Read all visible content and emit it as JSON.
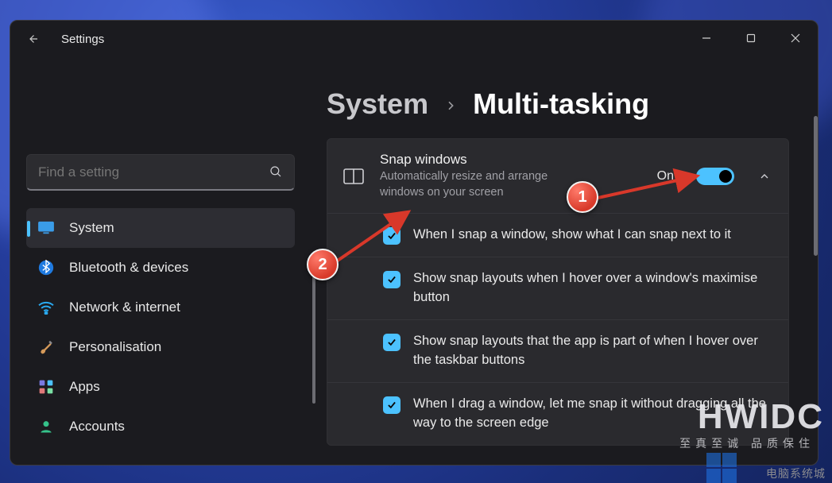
{
  "window": {
    "back_tooltip": "Back",
    "title": "Settings",
    "controls": {
      "minimize": "Minimize",
      "maximize": "Maximize",
      "close": "Close"
    }
  },
  "search": {
    "placeholder": "Find a setting"
  },
  "sidebar": {
    "items": [
      {
        "label": "System",
        "icon": "monitor-icon",
        "selected": true
      },
      {
        "label": "Bluetooth & devices",
        "icon": "bluetooth-icon",
        "selected": false
      },
      {
        "label": "Network & internet",
        "icon": "wifi-icon",
        "selected": false
      },
      {
        "label": "Personalisation",
        "icon": "paintbrush-icon",
        "selected": false
      },
      {
        "label": "Apps",
        "icon": "apps-icon",
        "selected": false
      },
      {
        "label": "Accounts",
        "icon": "person-icon",
        "selected": false
      }
    ]
  },
  "breadcrumb": {
    "parent": "System",
    "current": "Multi-tasking"
  },
  "snap": {
    "title": "Snap windows",
    "subtitle": "Automatically resize and arrange windows on your screen",
    "state_label": "On",
    "state": true,
    "expanded": true,
    "options": [
      {
        "label": "When I snap a window, show what I can snap next to it",
        "checked": true
      },
      {
        "label": "Show snap layouts when I hover over a window's maximise button",
        "checked": true
      },
      {
        "label": "Show snap layouts that the app is part of when I hover over the taskbar buttons",
        "checked": true
      },
      {
        "label": "When I drag a window, let me snap it without dragging all the way to the screen edge",
        "checked": true
      }
    ]
  },
  "annotations": {
    "one": "1",
    "two": "2"
  },
  "watermarks": {
    "big": "HWIDC",
    "tag": "至真至诚 品质保住",
    "corner": "电脑系统城"
  },
  "colors": {
    "accent": "#4cc2ff",
    "window_bg": "#1b1b1f",
    "card_bg": "#2a2a2e"
  }
}
